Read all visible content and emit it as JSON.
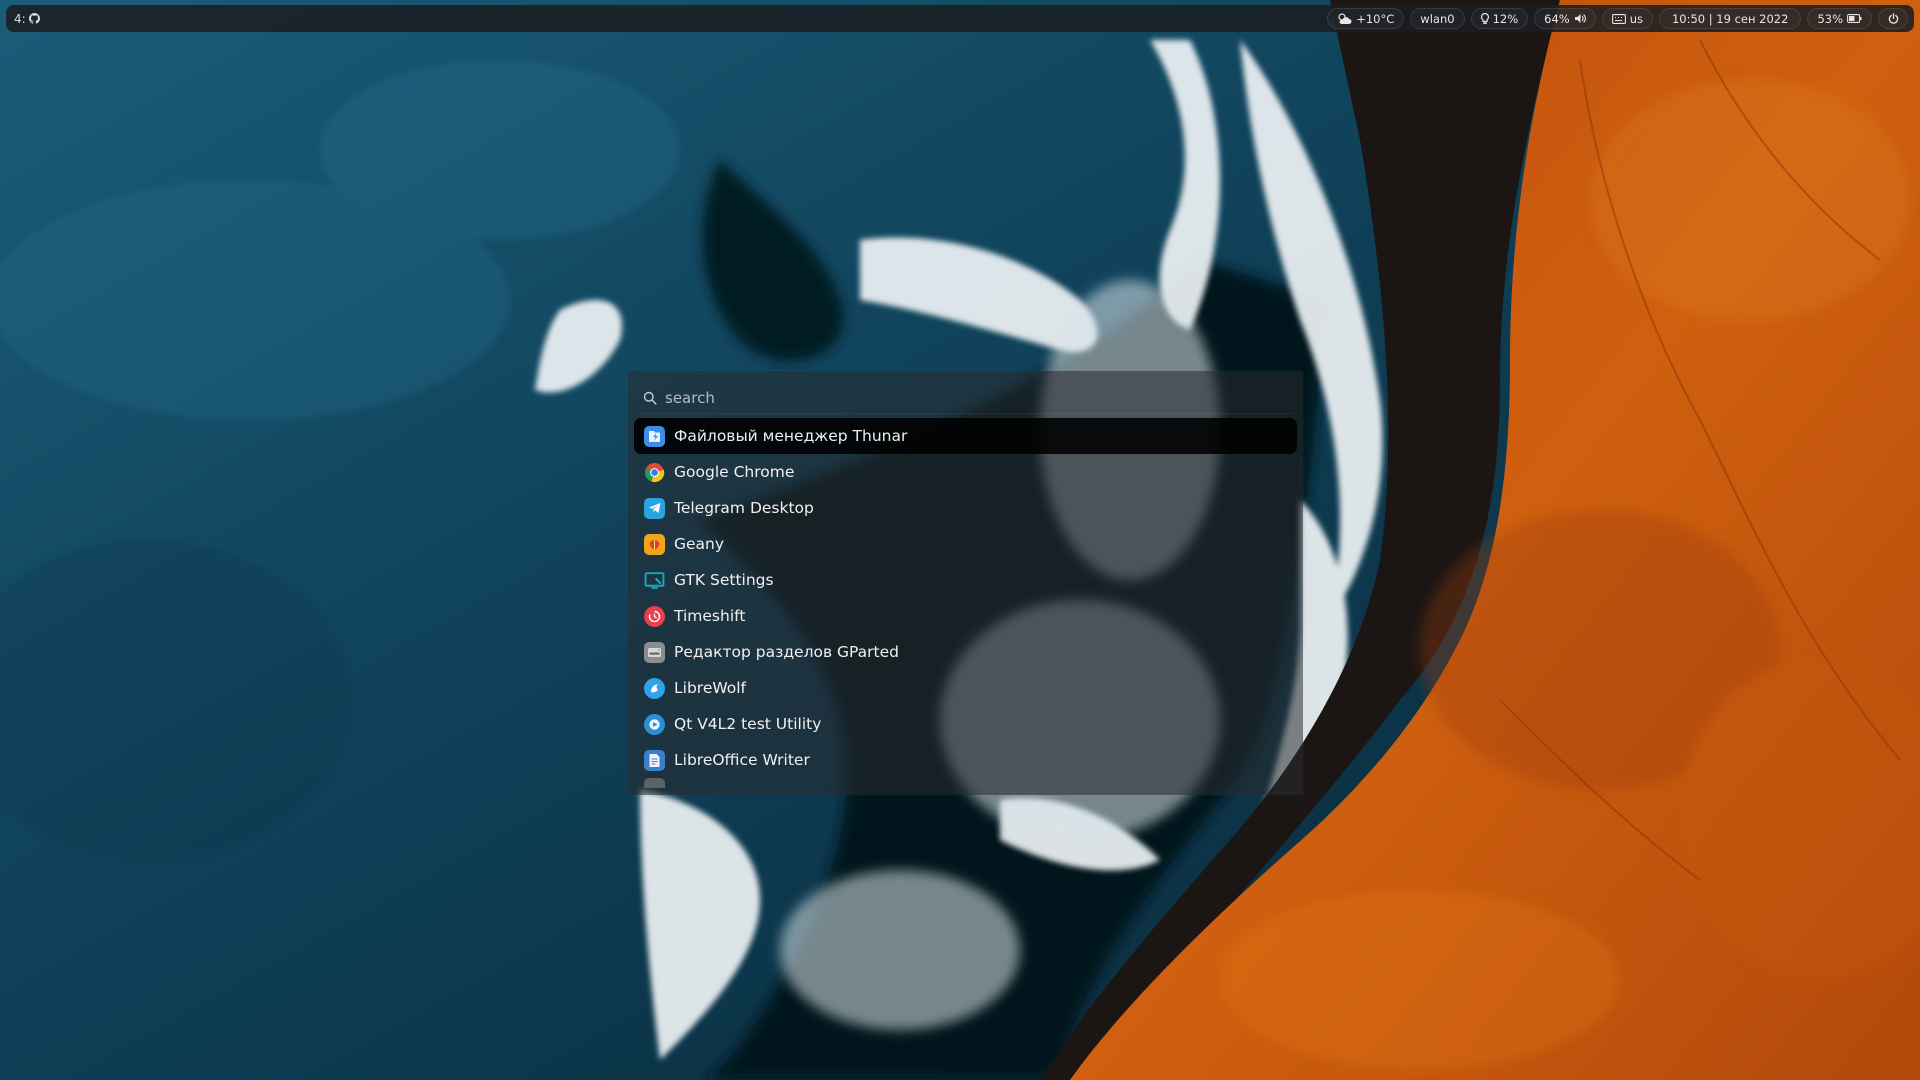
{
  "colors": {
    "bar_bg": "#1a1e22",
    "launcher_bg": "#282c30",
    "selection_bg": "#000000",
    "text": "#f0f0f0",
    "ocean": "#0c3449",
    "cliff": "#c4520c"
  },
  "topbar": {
    "workspace": "4:",
    "workspace_icon": "github-icon",
    "weather": "+10°C",
    "network": "wlan0",
    "brightness": "12%",
    "volume": "64%",
    "keyboard_layout": "us",
    "clock": "10:50 | 19 сен 2022",
    "battery": "53%"
  },
  "launcher": {
    "search_placeholder": "search",
    "items": [
      {
        "label": "Файловый менеджер Thunar",
        "icon": "thunar-icon",
        "color": "#3d8de6"
      },
      {
        "label": "Google Chrome",
        "icon": "chrome-icon",
        "color": "#e8e8e8"
      },
      {
        "label": "Telegram Desktop",
        "icon": "telegram-icon",
        "color": "#2aa3e0"
      },
      {
        "label": "Geany",
        "icon": "geany-icon",
        "color": "#f2a51a"
      },
      {
        "label": "GTK Settings",
        "icon": "gtk-settings-icon",
        "color": "#1f8fa8"
      },
      {
        "label": "Timeshift",
        "icon": "timeshift-icon",
        "color": "#e8404f"
      },
      {
        "label": "Редактор разделов GParted",
        "icon": "gparted-icon",
        "color": "#8c8c8c"
      },
      {
        "label": "LibreWolf",
        "icon": "librewolf-icon",
        "color": "#31a2e6"
      },
      {
        "label": "Qt V4L2 test Utility",
        "icon": "qv4l2-icon",
        "color": "#2b8fd6"
      },
      {
        "label": "LibreOffice Writer",
        "icon": "writer-icon",
        "color": "#3c7fc8"
      }
    ]
  }
}
